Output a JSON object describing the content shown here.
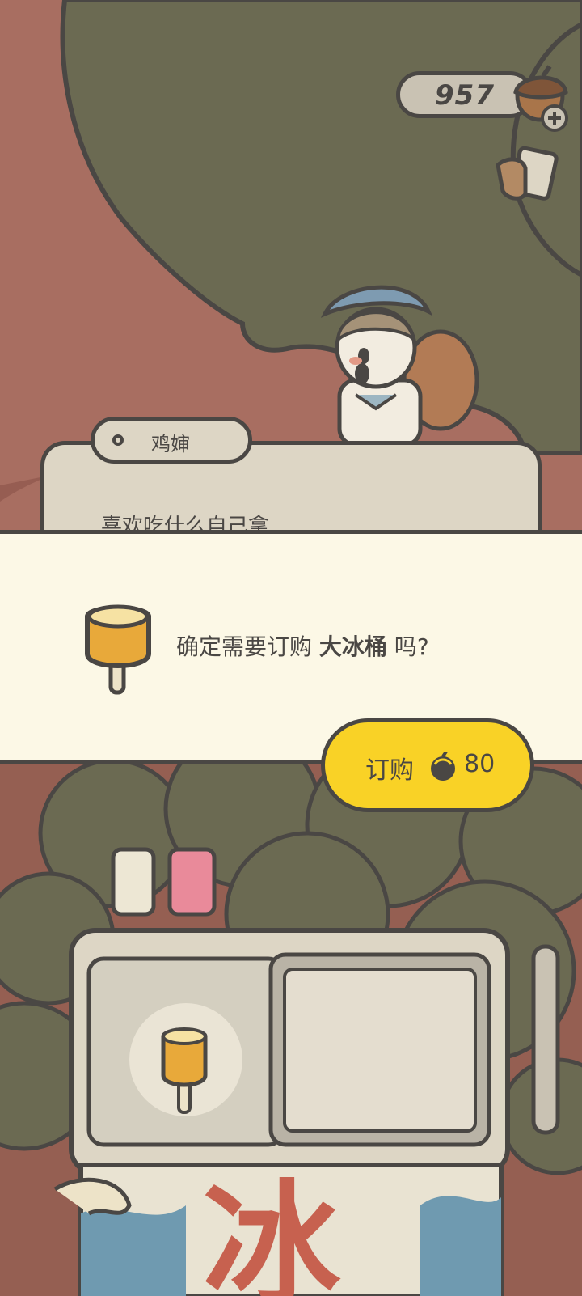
{
  "currency": {
    "value": "957",
    "coin_icon": "acorn-icon",
    "add_icon": "plus-icon"
  },
  "dialog": {
    "speaker_name": "鸡婶",
    "text": "喜欢吃什么自己拿"
  },
  "confirm": {
    "prefix": "确定需要订购 ",
    "item_name": "大冰桶",
    "suffix": " 吗?",
    "item_icon": "ice-pop-icon"
  },
  "buy_button": {
    "label": "订购",
    "price": "80",
    "price_icon": "acorn-icon"
  },
  "freezer": {
    "sign_char": "冰"
  },
  "colors": {
    "outline": "#4a4744",
    "panel": "#fcf8e6",
    "button": "#f9d226",
    "foliage": "#6b6a52",
    "ground": "#a86e61"
  }
}
